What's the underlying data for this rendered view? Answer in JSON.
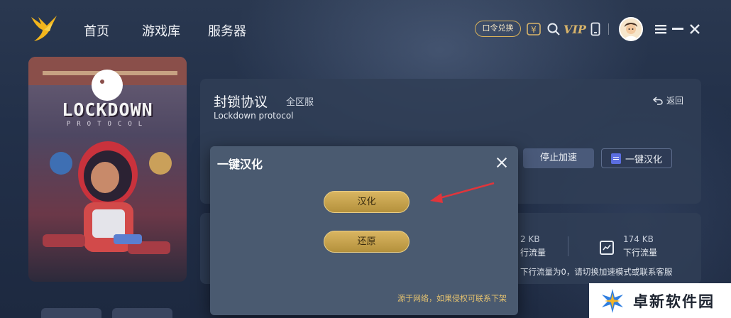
{
  "nav": {
    "items": [
      "首页",
      "游戏库",
      "服务器"
    ],
    "code_exchange": "口令兑换",
    "vip": "VIP"
  },
  "game": {
    "cover_title": "LOCKDOWN",
    "cover_subtitle": "PROTOCOL",
    "title": "封锁协议",
    "region": "全区服",
    "english_name": "Lockdown protocol",
    "back_label": "返回",
    "stop_label": "停止加速",
    "localize_label": "一键汉化"
  },
  "stats": {
    "up_value": "2 KB",
    "up_label": "行流量",
    "down_value": "174 KB",
    "down_label": "下行流量",
    "notice": "下行流量为0，请切换加速模式或联系客服"
  },
  "modal": {
    "title": "一键汉化",
    "localize_button": "汉化",
    "restore_button": "还原",
    "footer": "源于网络，如果侵权可联系下架"
  },
  "watermark": {
    "text": "卓新软件园"
  },
  "colors": {
    "gold": "#d9b561",
    "accent_blue": "#5b6ee0",
    "arrow_red": "#e0353b"
  }
}
